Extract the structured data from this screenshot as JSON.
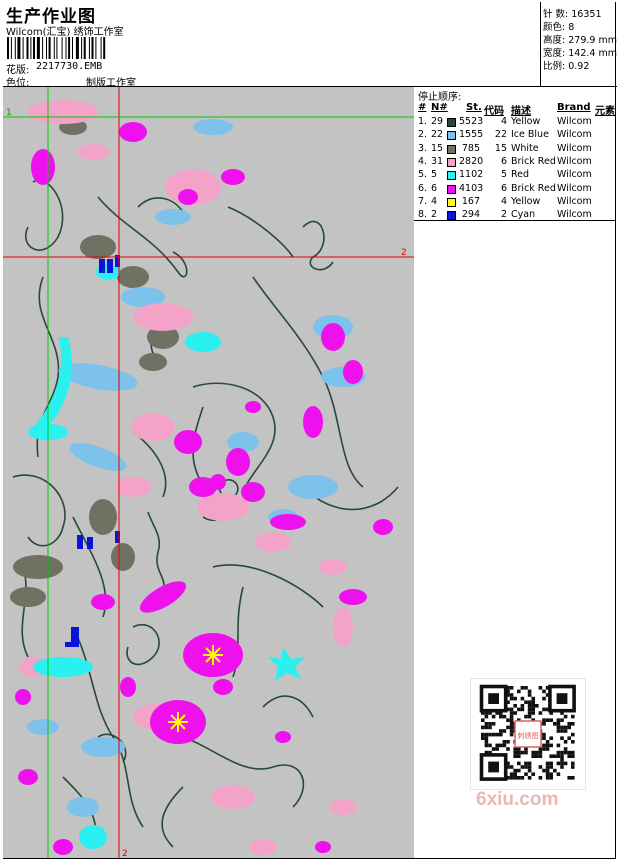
{
  "header": {
    "title": "生产作业图",
    "studio": "Wilcom(汇宝) 绣饰工作室",
    "pattern_label": "花版:",
    "pattern_value": "2217730.EMB",
    "colorway_label": "色位:",
    "colorway_value": "制版工作室"
  },
  "stats": [
    {
      "label": "针 数:",
      "value": "16351"
    },
    {
      "label": "颜色:",
      "value": "8"
    },
    {
      "label": "高度:",
      "value": "279.9 mm"
    },
    {
      "label": "宽度:",
      "value": "142.4 mm"
    },
    {
      "label": "比例:",
      "value": "0.92"
    }
  ],
  "canvas": {
    "background": "#c3c3c3",
    "guide_h_label": "2",
    "guide_v_label": "2",
    "origin_label": "1"
  },
  "stop_sequence": {
    "title": "停止顺序:",
    "headers": {
      "seq": "#",
      "num": "N#",
      "stitches": "St.",
      "code": "代码",
      "desc": "描述",
      "brand": "Brand",
      "element": "元素"
    },
    "rows": [
      {
        "seq": "1.",
        "num": "29",
        "color": "#1f4a36",
        "stitches": "5523",
        "code": "4",
        "desc": "Yellow",
        "brand": "Wilcom"
      },
      {
        "seq": "2.",
        "num": "22",
        "color": "#7cc2ea",
        "stitches": "1555",
        "code": "22",
        "desc": "Ice Blue",
        "brand": "Wilcom"
      },
      {
        "seq": "3.",
        "num": "15",
        "color": "#6f7262",
        "stitches": "785",
        "code": "15",
        "desc": "White",
        "brand": "Wilcom"
      },
      {
        "seq": "4.",
        "num": "31",
        "color": "#f4a3c8",
        "stitches": "2820",
        "code": "6",
        "desc": "Brick Red",
        "brand": "Wilcom"
      },
      {
        "seq": "5.",
        "num": "5",
        "color": "#2af0f0",
        "stitches": "1102",
        "code": "5",
        "desc": "Red",
        "brand": "Wilcom"
      },
      {
        "seq": "6.",
        "num": "6",
        "color": "#ee11ee",
        "stitches": "4103",
        "code": "6",
        "desc": "Brick Red",
        "brand": "Wilcom"
      },
      {
        "seq": "7.",
        "num": "4",
        "color": "#ffff00",
        "stitches": "167",
        "code": "4",
        "desc": "Yellow",
        "brand": "Wilcom"
      },
      {
        "seq": "8.",
        "num": "2",
        "color": "#0a14d8",
        "stitches": "294",
        "code": "2",
        "desc": "Cyan",
        "brand": "Wilcom"
      }
    ]
  },
  "watermark": "6xiu.com",
  "qr_badge": "刺绣图"
}
